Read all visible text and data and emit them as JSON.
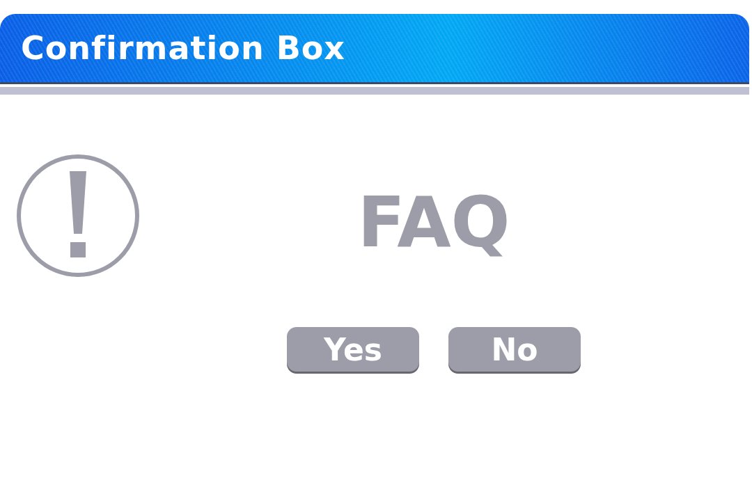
{
  "window": {
    "title": "Confirmation Box"
  },
  "message": "FAQ",
  "buttons": [
    {
      "label": "Yes"
    },
    {
      "label": "No"
    }
  ]
}
